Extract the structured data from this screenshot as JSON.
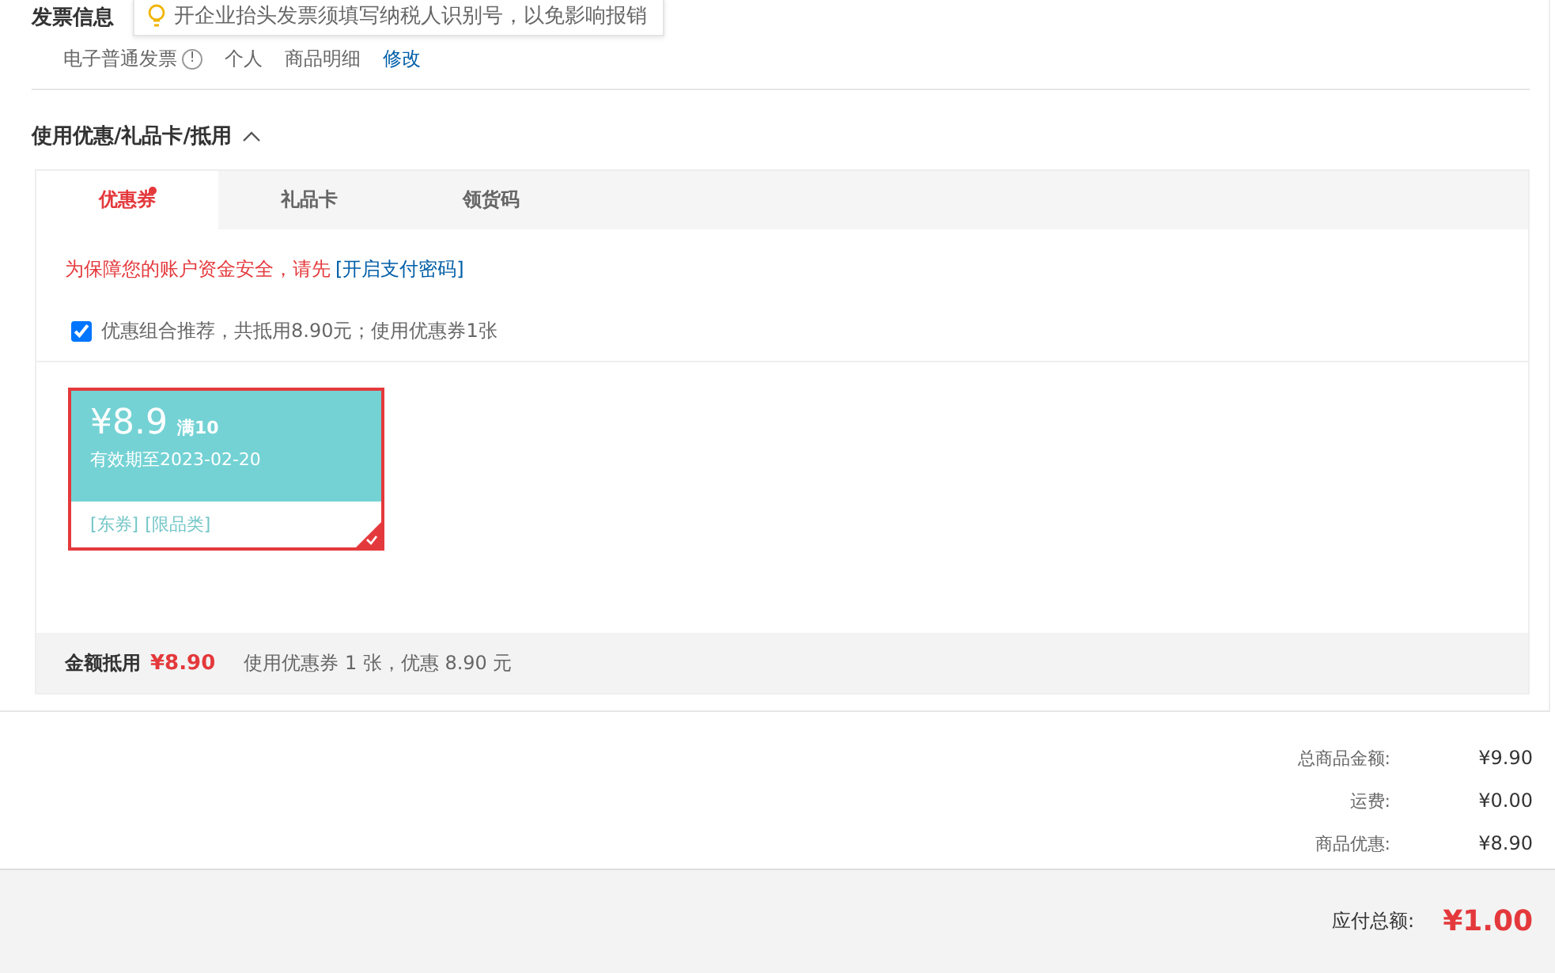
{
  "invoice": {
    "title": "发票信息",
    "tip": "开企业抬头发票须填写纳税人识别号，以免影响报销",
    "type": "电子普通发票",
    "info_mark": "!",
    "items": [
      "个人",
      "商品明细"
    ],
    "edit_link": "修改"
  },
  "discount_section": {
    "title": "使用优惠/礼品卡/抵用",
    "expanded": true,
    "tabs": [
      {
        "label": "优惠券",
        "selected": true,
        "dot": true
      },
      {
        "label": "礼品卡",
        "selected": false,
        "dot": false
      },
      {
        "label": "领货码",
        "selected": false,
        "dot": false
      }
    ],
    "warning": "为保障您的账户资金安全，请先",
    "warning_link": "[开启支付密码]",
    "recommend": {
      "label": "优惠组合推荐，共抵用8.90元；使用优惠券1张",
      "checked": true
    },
    "coupons": [
      {
        "amount": "¥8.9",
        "condition": "满10",
        "validity": "有效期至2023-02-20",
        "tags": [
          "[东券]",
          "[限品类]"
        ],
        "selected": true
      }
    ],
    "summary": {
      "label": "金额抵用",
      "amount": "¥8.90",
      "detail": "使用优惠券 1 张，优惠 8.90 元"
    }
  },
  "totals": [
    {
      "label": "总商品金额:",
      "value": "¥9.90"
    },
    {
      "label": "运费:",
      "value": "¥0.00"
    },
    {
      "label": "商品优惠:",
      "value": "¥8.90"
    }
  ],
  "payable": {
    "label": "应付总额:",
    "value": "¥1.00"
  }
}
